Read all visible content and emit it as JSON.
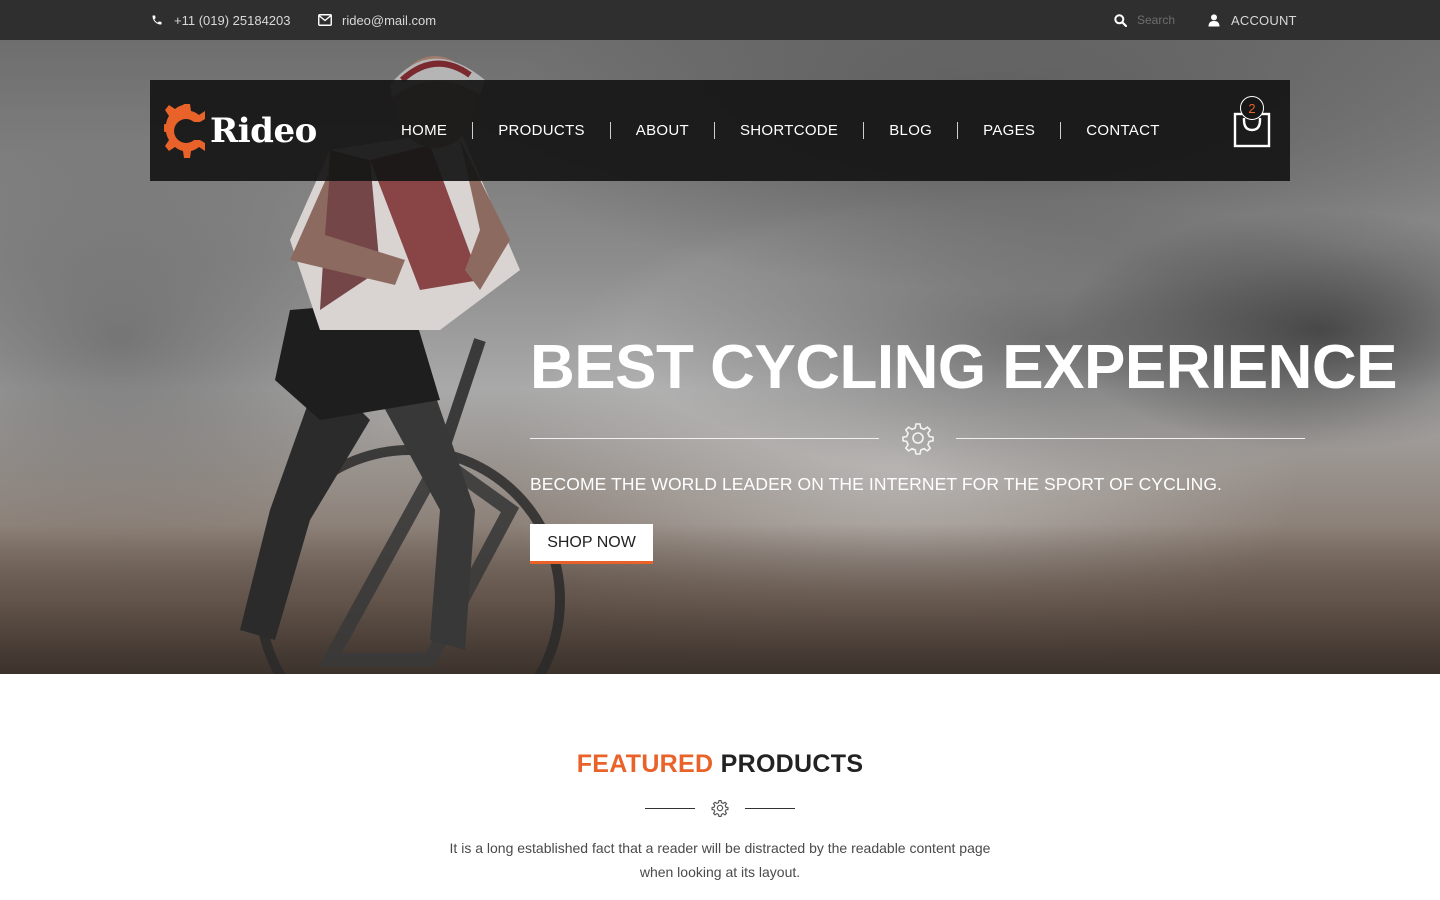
{
  "topbar": {
    "phone": "+11 (019) 25184203",
    "email": "rideo@mail.com",
    "search_placeholder": "Search",
    "account_label": "ACCOUNT",
    "icons": [
      "phone-icon",
      "envelope-icon",
      "search-icon",
      "user-icon"
    ]
  },
  "brand": {
    "logo_text": "Rideo",
    "accent_color": "#e8622a"
  },
  "nav": {
    "items": [
      "HOME",
      "PRODUCTS",
      "ABOUT",
      "SHORTCODE",
      "BLOG",
      "PAGES",
      "CONTACT"
    ]
  },
  "cart": {
    "count": "2"
  },
  "hero": {
    "title": "BEST CYCLING EXPERIENCE",
    "subtitle": "BECOME THE WORLD LEADER ON THE INTERNET FOR THE SPORT OF CYCLING.",
    "cta_label": "SHOP NOW"
  },
  "featured": {
    "title_accent": "FEATURED",
    "title_rest": "PRODUCTS",
    "description_line1": "It is a long established fact that a reader will be distracted by the readable content page",
    "description_line2": "when looking at its layout."
  }
}
